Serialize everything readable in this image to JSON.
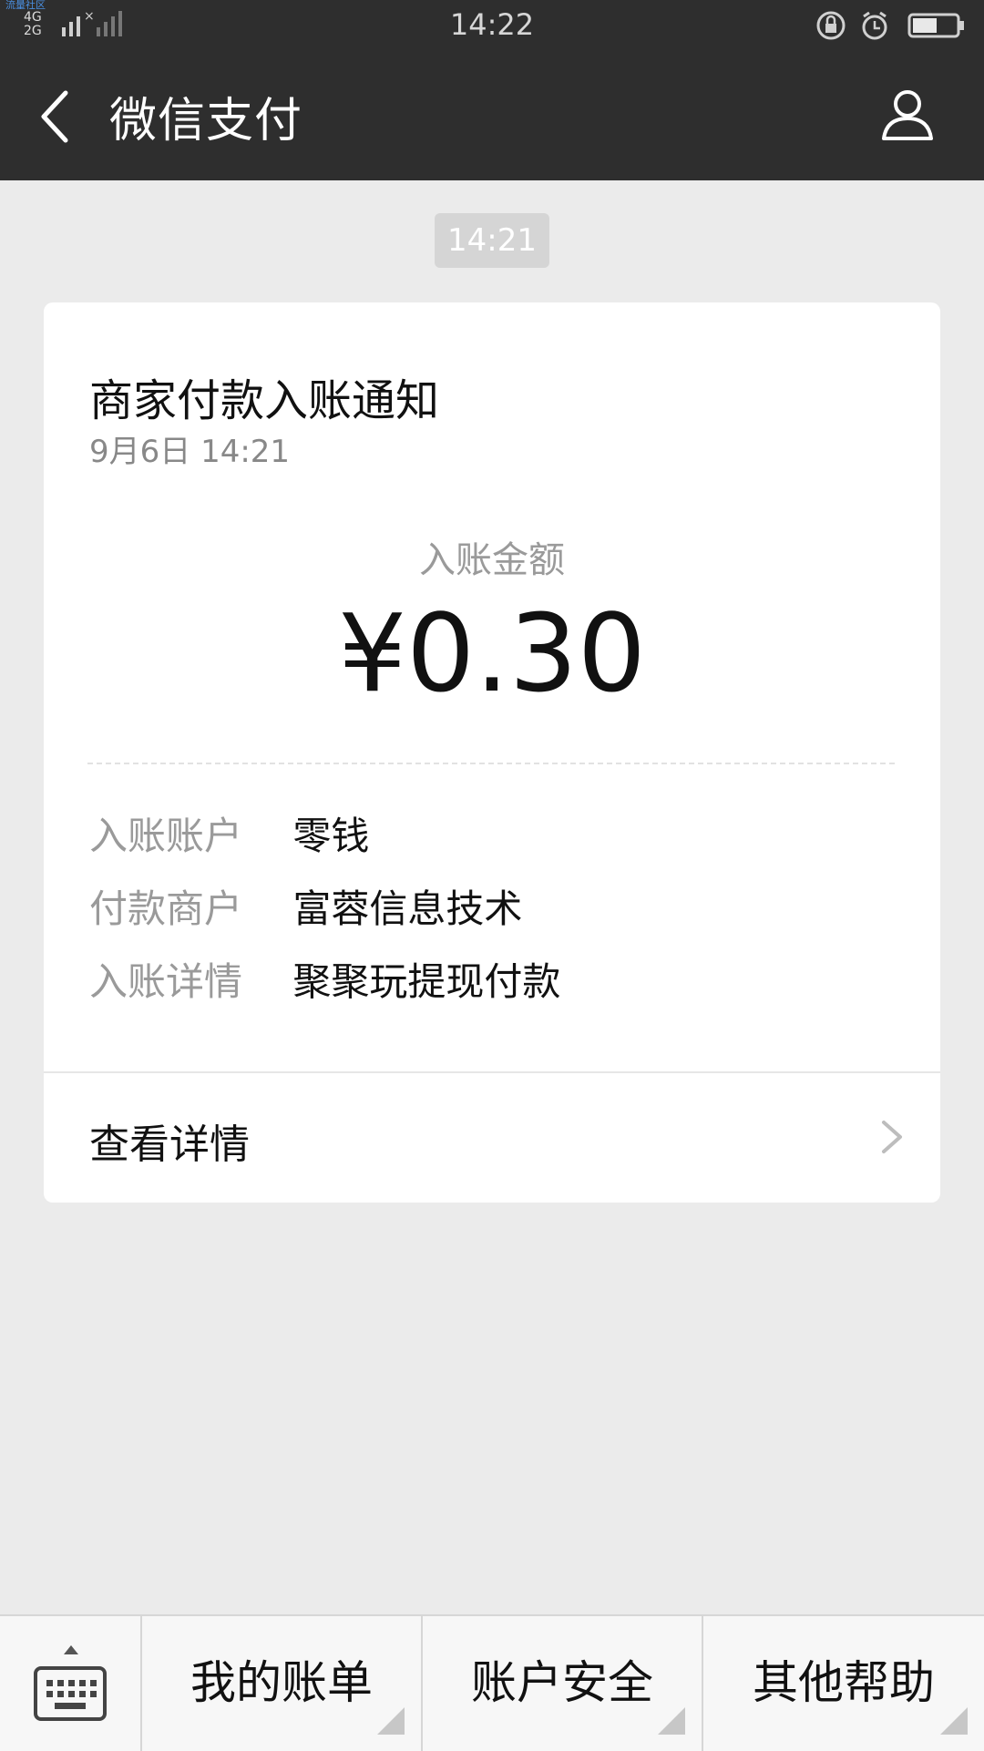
{
  "statusbar": {
    "watermark": "流量社区",
    "network": "4G 2G",
    "time": "14:22"
  },
  "header": {
    "title": "微信支付"
  },
  "chat": {
    "time_chip": "14:21"
  },
  "card": {
    "title": "商家付款入账通知",
    "date": "9月6日  14:21",
    "amount_label": "入账金额",
    "amount_value": "¥0.30",
    "details": [
      {
        "key": "入账账户",
        "value": "零钱"
      },
      {
        "key": "付款商户",
        "value": "富蓉信息技术"
      },
      {
        "key": "入账详情",
        "value": "聚聚玩提现付款"
      }
    ],
    "view_details": "查看详情"
  },
  "bottom_menu": {
    "items": [
      {
        "label": "我的账单"
      },
      {
        "label": "账户安全"
      },
      {
        "label": "其他帮助"
      }
    ]
  }
}
